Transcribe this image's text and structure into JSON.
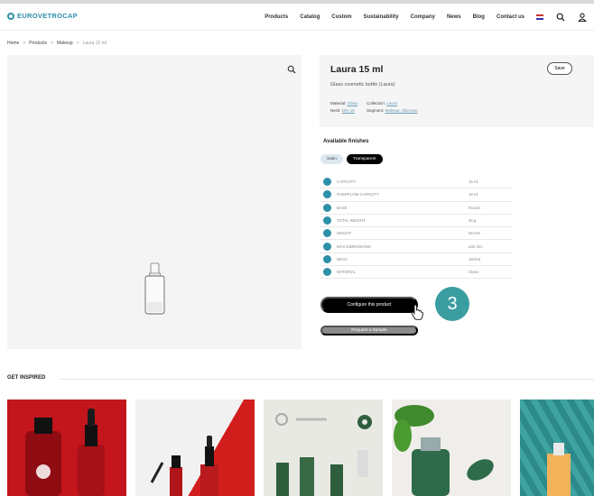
{
  "header": {
    "logo_text": "EUROVETROCAP",
    "nav": [
      "Products",
      "Catalog",
      "Custom",
      "Sustainability",
      "Company",
      "News",
      "Blog",
      "Contact us"
    ]
  },
  "breadcrumb": {
    "items": [
      "Home",
      "Products",
      "Makeup",
      "Laura 15 ml"
    ],
    "separator": ">"
  },
  "product": {
    "title": "Laura 15 ml",
    "subtitle": "Glass cosmetic bottle (Laura)",
    "save_label": "Save",
    "meta": {
      "material_key": "Material:",
      "material_val": "Glass",
      "neck_key": "Neck:",
      "neck_val": "DIN 18",
      "collection_key": "Collection:",
      "collection_val": "Laura",
      "segment_key": "Segment:",
      "segment_val": "Makeup, Skincare"
    }
  },
  "finishes": {
    "title": "Available finishes",
    "options": [
      "Satin",
      "Transparent"
    ],
    "selected": "Transparent"
  },
  "specs": [
    {
      "label": "Capacity",
      "value": "15 ml"
    },
    {
      "label": "Overflow capacity",
      "value": "18 ml"
    },
    {
      "label": "Base",
      "value": "Round"
    },
    {
      "label": "Total weight",
      "value": "36 g"
    },
    {
      "label": "Height",
      "value": "58 mm"
    },
    {
      "label": "Max dimensions",
      "value": "ø32 mm"
    },
    {
      "label": "Neck",
      "value": "18/415"
    },
    {
      "label": "Material",
      "value": "Glass"
    }
  ],
  "cta": {
    "configure_label": "Configure this product",
    "sample_label": "Request a Sample"
  },
  "step_badge": "3",
  "inspired": {
    "title": "GET INSPIRED"
  },
  "colors": {
    "accent": "#2e8fa8",
    "badge": "#3a9ea1"
  }
}
